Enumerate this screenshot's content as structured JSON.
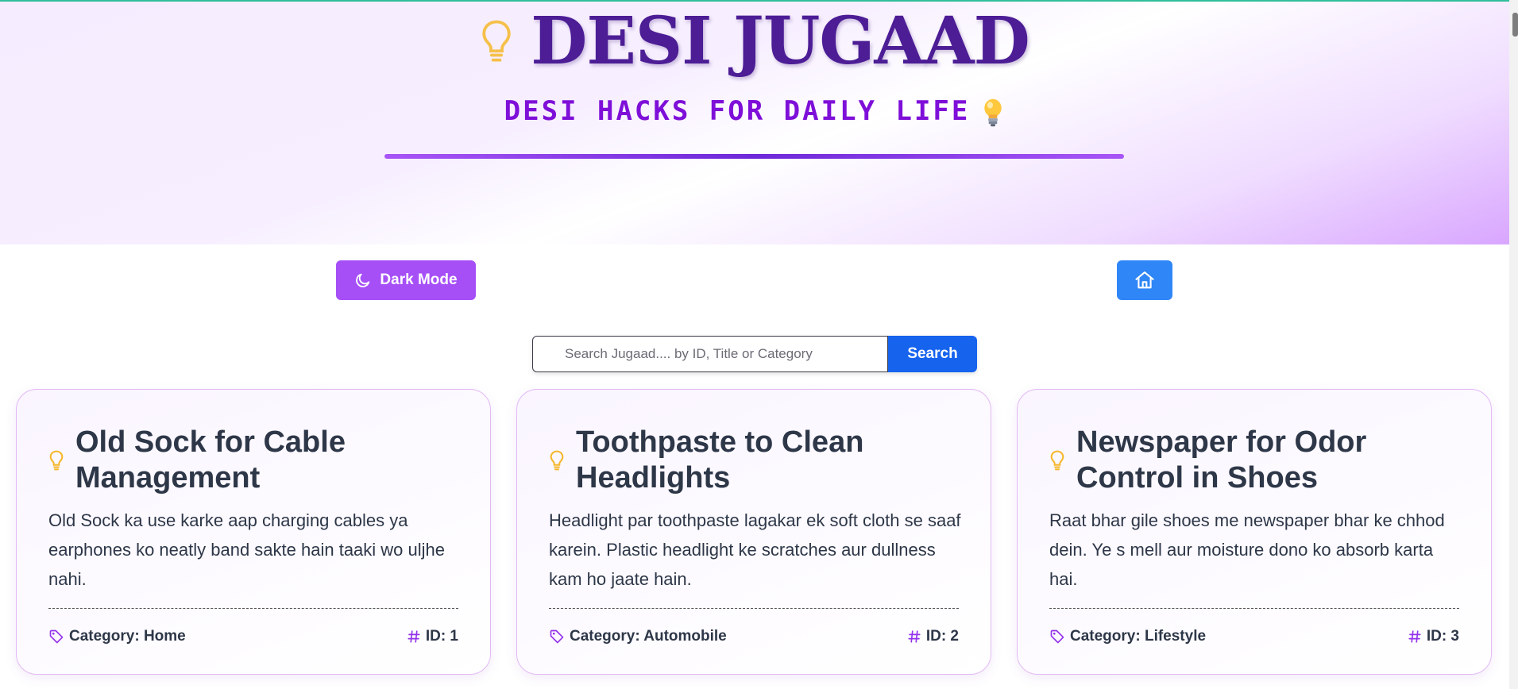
{
  "header": {
    "title": "DESI JUGAAD",
    "subtitle": "DESI HACKS FOR DAILY LIFE"
  },
  "controls": {
    "dark_mode_label": "Dark Mode"
  },
  "search": {
    "placeholder": "Search Jugaad.... by ID, Title or Category",
    "button_label": "Search"
  },
  "cards": [
    {
      "title": "Old Sock for Cable Management",
      "description": "Old Sock ka use karke aap charging cables ya earphones ko neatly band sakte hain taaki wo uljhe nahi.",
      "category": "Category: Home",
      "id": "ID: 1"
    },
    {
      "title": "Toothpaste to Clean Headlights",
      "description": "Headlight par toothpaste lagakar ek soft cloth se saaf karein. Plastic headlight ke scratches aur dullness kam ho jaate hain.",
      "category": "Category: Automobile",
      "id": "ID: 2"
    },
    {
      "title": "Newspaper for Odor Control in Shoes",
      "description": "Raat bhar gile shoes me newspaper bhar ke chhod dein. Ye s mell aur moisture dono ko absorb karta hai.",
      "category": "Category: Lifestyle",
      "id": "ID: 3"
    }
  ],
  "colors": {
    "title": "#4c1d95",
    "subtitle": "#7e0fd8",
    "dark_mode_button": "#a64ff7",
    "home_button": "#2f86f6",
    "search_button": "#1663ee",
    "accent_icon": "#9333ea",
    "bulb": "#f5b82e"
  },
  "icons": {
    "header": "lightbulb-icon",
    "dark_mode": "moon-icon",
    "home": "home-icon",
    "card": "lightbulb-icon",
    "category": "tag-icon",
    "id": "hash-icon"
  }
}
